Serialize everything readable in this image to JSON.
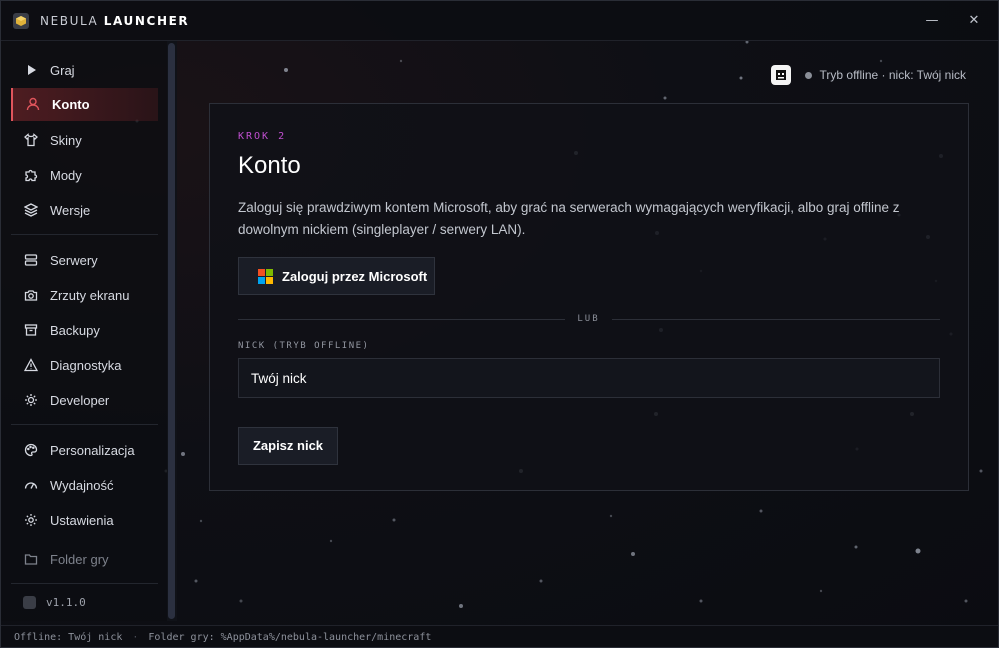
{
  "window": {
    "title_light": "NEBULA",
    "title_bold": "LAUNCHER",
    "minimize_glyph": "—",
    "close_glyph": "✕"
  },
  "sidebar": {
    "groups": [
      [
        {
          "label": "Graj",
          "icon": "play-icon"
        },
        {
          "label": "Konto",
          "icon": "user-icon",
          "active": true
        },
        {
          "label": "Skiny",
          "icon": "shirt-icon"
        },
        {
          "label": "Mody",
          "icon": "puzzle-icon"
        },
        {
          "label": "Wersje",
          "icon": "layers-icon"
        }
      ],
      [
        {
          "label": "Serwery",
          "icon": "server-icon"
        },
        {
          "label": "Zrzuty ekranu",
          "icon": "camera-icon"
        },
        {
          "label": "Backupy",
          "icon": "archive-icon"
        },
        {
          "label": "Diagnostyka",
          "icon": "warning-icon"
        },
        {
          "label": "Developer",
          "icon": "bug-icon"
        }
      ],
      [
        {
          "label": "Personalizacja",
          "icon": "palette-icon"
        },
        {
          "label": "Wydajność",
          "icon": "gauge-icon"
        },
        {
          "label": "Ustawienia",
          "icon": "gear-icon"
        }
      ]
    ],
    "folder_label": "Folder gry",
    "version": "v1.1.0"
  },
  "status": {
    "text": "Tryb offline · nick: Twój nick"
  },
  "card": {
    "step": "KROK 2",
    "title": "Konto",
    "description": "Zaloguj się prawdziwym kontem Microsoft, aby grać na serwerach wymagających weryfikacji, albo graj offline z dowolnym nickiem (singleplayer / serwery LAN).",
    "ms_button": "Zaloguj przez Microsoft",
    "or_text": "LUB",
    "nick_label": "NICK (TRYB OFFLINE)",
    "nick_value": "Twój nick",
    "save_button": "Zapisz nick"
  },
  "footer": {
    "offline": "Offline: Twój nick",
    "folder": "Folder gry: %AppData%/nebula-launcher/minecraft"
  },
  "colors": {
    "accent_red": "#e0555c",
    "step_purple": "#c04fd0",
    "ms_red": "#f25022",
    "ms_green": "#7fba00",
    "ms_blue": "#00a4ef",
    "ms_yellow": "#ffb900"
  }
}
